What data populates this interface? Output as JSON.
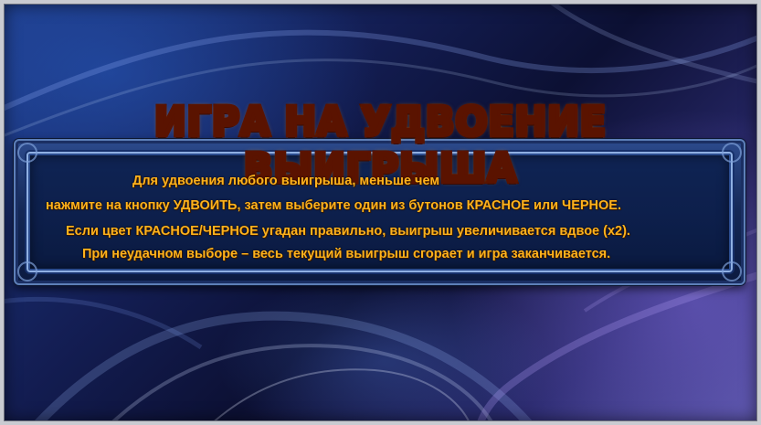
{
  "colors": {
    "accent_text": "#ffb21c",
    "title_gold": "#ffd02a",
    "panel_blue": "#142856",
    "frame_silver": "#c9cbd1"
  },
  "title": "ИГРА НА УДВОЕНИЕ ВЫИГРЫША",
  "lines": [
    "Для удвоения любого выигрыша, меньше чем",
    "нажмите на кнопку УДВОИТЬ, затем выберите один из бутонов КРАСНОЕ или ЧЕРНОЕ.",
    "Если цвет КРАСНОЕ/ЧЕРНОЕ угадан правильно, выигрыш увеличивается вдвое (x2).",
    "При неудачном выборе – весь текущий выигрыш сгорает и игра заканчивается."
  ]
}
